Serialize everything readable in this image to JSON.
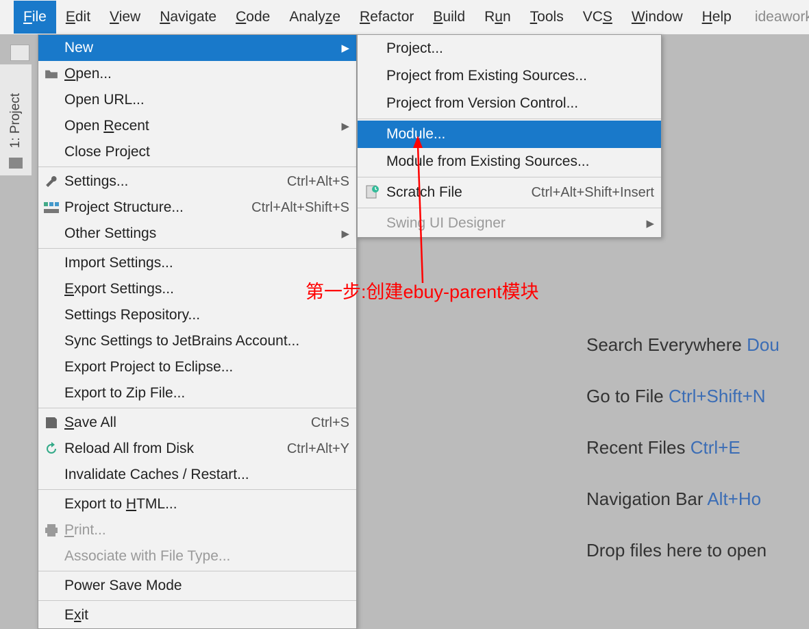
{
  "menubar": [
    "File",
    "Edit",
    "View",
    "Navigate",
    "Code",
    "Analyze",
    "Refactor",
    "Build",
    "Run",
    "Tools",
    "VCS",
    "Window",
    "Help"
  ],
  "project_name": "ideawork",
  "sidebar_label": "1: Project",
  "file_menu": {
    "new": "New",
    "open": "Open...",
    "open_url": "Open URL...",
    "open_recent": "Open Recent",
    "close_project": "Close Project",
    "settings": "Settings...",
    "settings_sc": "Ctrl+Alt+S",
    "proj_struct": "Project Structure...",
    "proj_struct_sc": "Ctrl+Alt+Shift+S",
    "other_settings": "Other Settings",
    "import_settings": "Import Settings...",
    "export_settings": "Export Settings...",
    "settings_repo": "Settings Repository...",
    "sync_settings": "Sync Settings to JetBrains Account...",
    "export_eclipse": "Export Project to Eclipse...",
    "export_zip": "Export to Zip File...",
    "save_all": "Save All",
    "save_all_sc": "Ctrl+S",
    "reload": "Reload All from Disk",
    "reload_sc": "Ctrl+Alt+Y",
    "invalidate": "Invalidate Caches / Restart...",
    "export_html": "Export to HTML...",
    "print": "Print...",
    "associate": "Associate with File Type...",
    "power_save": "Power Save Mode",
    "exit": "Exit"
  },
  "new_submenu": {
    "project": "Project...",
    "project_existing": "Project from Existing Sources...",
    "project_vcs": "Project from Version Control...",
    "module": "Module...",
    "module_existing": "Module from Existing Sources...",
    "scratch": "Scratch File",
    "scratch_sc": "Ctrl+Alt+Shift+Insert",
    "swing": "Swing UI Designer"
  },
  "annotation": "第一步:创建ebuy-parent模块",
  "tips": {
    "t1a": "Search Everywhere ",
    "t1b": "Dou",
    "t2a": "Go to File ",
    "t2b": "Ctrl+Shift+N",
    "t3a": "Recent Files ",
    "t3b": "Ctrl+E",
    "t4a": "Navigation Bar ",
    "t4b": "Alt+Ho",
    "t5": "Drop files here to open"
  }
}
